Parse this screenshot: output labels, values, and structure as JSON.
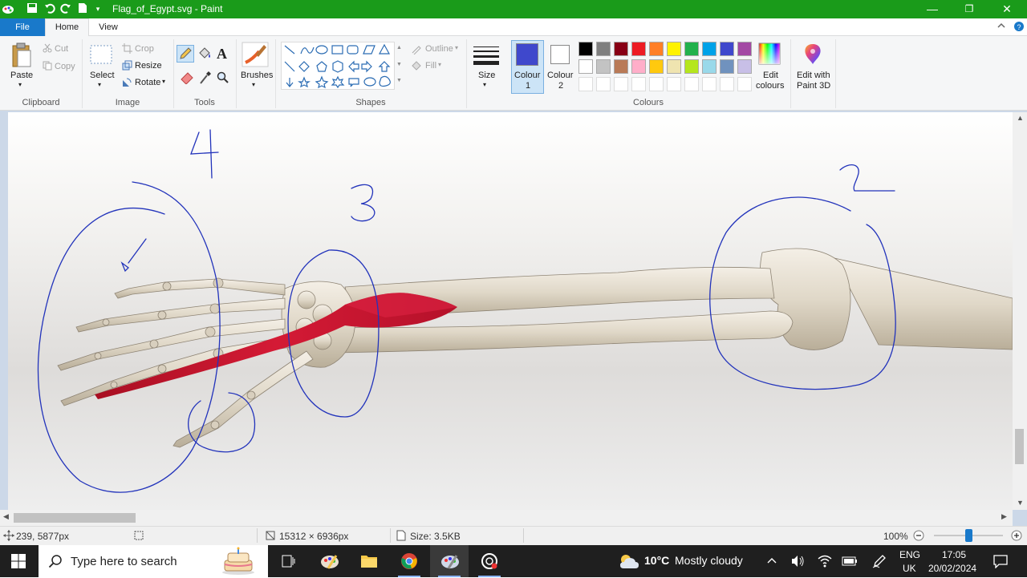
{
  "window": {
    "title": "Flag_of_Egypt.svg - Paint",
    "minimize_glyph": "—",
    "restore_glyph": "❐",
    "close_glyph": "✕"
  },
  "tabs": {
    "file": "File",
    "home": "Home",
    "view": "View"
  },
  "clipboard": {
    "paste": "Paste",
    "cut": "Cut",
    "copy": "Copy",
    "group": "Clipboard"
  },
  "image": {
    "crop": "Crop",
    "resize": "Resize",
    "rotate": "Rotate",
    "select": "Select",
    "group": "Image"
  },
  "tools": {
    "text_glyph": "A",
    "group": "Tools"
  },
  "brushes": {
    "label": "Brushes"
  },
  "shapes": {
    "outline": "Outline",
    "fill": "Fill",
    "group": "Shapes"
  },
  "size": {
    "label": "Size"
  },
  "colours": {
    "colour1_line1": "Colour",
    "colour1_line2": "1",
    "colour2_line1": "Colour",
    "colour2_line2": "2",
    "edit_line1": "Edit",
    "edit_line2": "colours",
    "group": "Colours",
    "colour1_value": "#3f48cc",
    "colour2_value": "#ffffff",
    "palette_row1": [
      "#000000",
      "#7f7f7f",
      "#880015",
      "#ed1c24",
      "#ff7f27",
      "#fff200",
      "#22b14c",
      "#00a2e8",
      "#3f48cc",
      "#a349a4"
    ],
    "palette_row2": [
      "#ffffff",
      "#c3c3c3",
      "#b97a57",
      "#ffaec9",
      "#ffc90e",
      "#efe4b0",
      "#b5e61d",
      "#99d9ea",
      "#7092be",
      "#c8bfe7"
    ]
  },
  "paint3d": {
    "line1": "Edit with",
    "line2": "Paint 3D"
  },
  "canvas": {
    "annotation_4": "4",
    "annotation_3": "3",
    "annotation_2": "2",
    "ink_color": "#2233bb",
    "muscle_color": "#c8102e"
  },
  "status": {
    "cursor_pos": "239, 5877px",
    "selection_size": "15312 × 6936px",
    "file_size": "Size: 3.5KB",
    "zoom": "100%",
    "zoom_level": 0.5
  },
  "taskbar": {
    "search_placeholder": "Type here to search",
    "weather_temp": "10°C",
    "weather_text": "Mostly cloudy",
    "lang1": "ENG",
    "lang2": "UK",
    "time": "17:05",
    "date": "20/02/2024"
  }
}
